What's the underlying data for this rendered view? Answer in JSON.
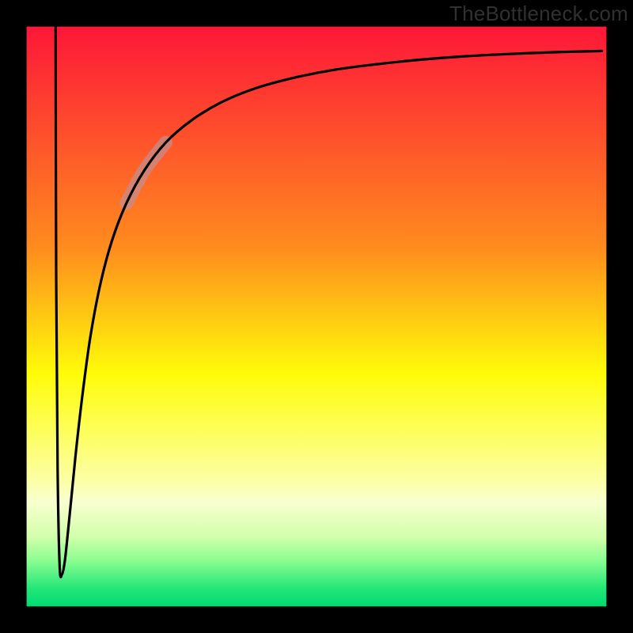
{
  "watermark": "TheBottleneck.com",
  "chart_data": {
    "type": "line",
    "title": "",
    "xlabel": "",
    "ylabel": "",
    "xlim": [
      0,
      100
    ],
    "ylim": [
      0,
      100
    ],
    "grid": false,
    "background": {
      "type": "vertical-gradient",
      "stops": [
        {
          "pct": 0.0,
          "color": "#fe1738"
        },
        {
          "pct": 0.38,
          "color": "#ff8b1e"
        },
        {
          "pct": 0.6,
          "color": "#fffc09"
        },
        {
          "pct": 0.78,
          "color": "#fcffa2"
        },
        {
          "pct": 0.82,
          "color": "#f9ffd0"
        },
        {
          "pct": 0.88,
          "color": "#d2ffab"
        },
        {
          "pct": 0.92,
          "color": "#8cfe91"
        },
        {
          "pct": 0.97,
          "color": "#23e578"
        },
        {
          "pct": 1.0,
          "color": "#02db70"
        }
      ]
    },
    "note": "x,y are percentages of the plot area (0-100); y is percent from TOP since the chart has no labeled axes",
    "series": [
      {
        "name": "curve",
        "color": "#000000",
        "x": [
          5.0,
          5.1,
          5.35,
          5.7,
          6.1,
          6.55,
          7.0,
          7.7,
          8.6,
          9.7,
          11.0,
          12.7,
          14.7,
          17.2,
          20.3,
          24.0,
          28.4,
          33.5,
          39.3,
          45.8,
          52.8,
          60.3,
          68.0,
          75.9,
          83.7,
          91.5,
          97.5,
          99.2
        ],
        "y": [
          0.0,
          42.0,
          76.0,
          93.0,
          94.5,
          92.5,
          88.5,
          81.5,
          72.5,
          63.0,
          53.5,
          44.5,
          37.0,
          30.5,
          24.8,
          20.0,
          16.2,
          13.1,
          10.7,
          8.9,
          7.5,
          6.5,
          5.7,
          5.1,
          4.7,
          4.4,
          4.25,
          4.2
        ]
      }
    ],
    "highlight": {
      "color": "#c38d90",
      "opacity": 0.72,
      "width_pct": 2.1,
      "segment_index_start": 13,
      "segment_index_end": 15
    },
    "frame": {
      "margin_pct": 4.2,
      "stroke": "#000000"
    }
  }
}
